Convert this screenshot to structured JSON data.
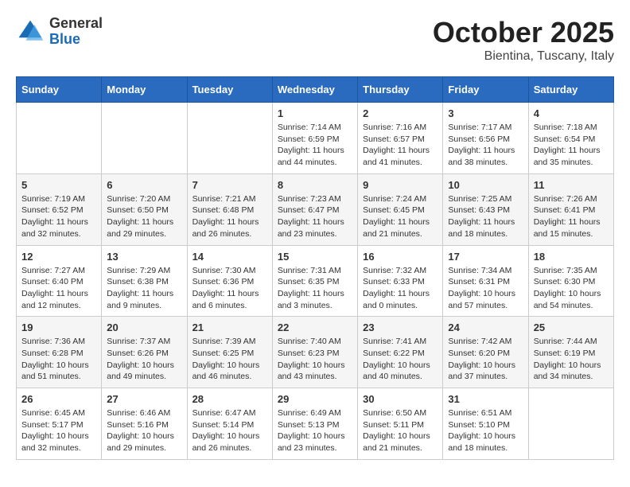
{
  "header": {
    "logo_general": "General",
    "logo_blue": "Blue",
    "title": "October 2025",
    "subtitle": "Bientina, Tuscany, Italy"
  },
  "weekdays": [
    "Sunday",
    "Monday",
    "Tuesday",
    "Wednesday",
    "Thursday",
    "Friday",
    "Saturday"
  ],
  "weeks": [
    [
      {
        "day": "",
        "info": ""
      },
      {
        "day": "",
        "info": ""
      },
      {
        "day": "",
        "info": ""
      },
      {
        "day": "1",
        "info": "Sunrise: 7:14 AM\nSunset: 6:59 PM\nDaylight: 11 hours and 44 minutes."
      },
      {
        "day": "2",
        "info": "Sunrise: 7:16 AM\nSunset: 6:57 PM\nDaylight: 11 hours and 41 minutes."
      },
      {
        "day": "3",
        "info": "Sunrise: 7:17 AM\nSunset: 6:56 PM\nDaylight: 11 hours and 38 minutes."
      },
      {
        "day": "4",
        "info": "Sunrise: 7:18 AM\nSunset: 6:54 PM\nDaylight: 11 hours and 35 minutes."
      }
    ],
    [
      {
        "day": "5",
        "info": "Sunrise: 7:19 AM\nSunset: 6:52 PM\nDaylight: 11 hours and 32 minutes."
      },
      {
        "day": "6",
        "info": "Sunrise: 7:20 AM\nSunset: 6:50 PM\nDaylight: 11 hours and 29 minutes."
      },
      {
        "day": "7",
        "info": "Sunrise: 7:21 AM\nSunset: 6:48 PM\nDaylight: 11 hours and 26 minutes."
      },
      {
        "day": "8",
        "info": "Sunrise: 7:23 AM\nSunset: 6:47 PM\nDaylight: 11 hours and 23 minutes."
      },
      {
        "day": "9",
        "info": "Sunrise: 7:24 AM\nSunset: 6:45 PM\nDaylight: 11 hours and 21 minutes."
      },
      {
        "day": "10",
        "info": "Sunrise: 7:25 AM\nSunset: 6:43 PM\nDaylight: 11 hours and 18 minutes."
      },
      {
        "day": "11",
        "info": "Sunrise: 7:26 AM\nSunset: 6:41 PM\nDaylight: 11 hours and 15 minutes."
      }
    ],
    [
      {
        "day": "12",
        "info": "Sunrise: 7:27 AM\nSunset: 6:40 PM\nDaylight: 11 hours and 12 minutes."
      },
      {
        "day": "13",
        "info": "Sunrise: 7:29 AM\nSunset: 6:38 PM\nDaylight: 11 hours and 9 minutes."
      },
      {
        "day": "14",
        "info": "Sunrise: 7:30 AM\nSunset: 6:36 PM\nDaylight: 11 hours and 6 minutes."
      },
      {
        "day": "15",
        "info": "Sunrise: 7:31 AM\nSunset: 6:35 PM\nDaylight: 11 hours and 3 minutes."
      },
      {
        "day": "16",
        "info": "Sunrise: 7:32 AM\nSunset: 6:33 PM\nDaylight: 11 hours and 0 minutes."
      },
      {
        "day": "17",
        "info": "Sunrise: 7:34 AM\nSunset: 6:31 PM\nDaylight: 10 hours and 57 minutes."
      },
      {
        "day": "18",
        "info": "Sunrise: 7:35 AM\nSunset: 6:30 PM\nDaylight: 10 hours and 54 minutes."
      }
    ],
    [
      {
        "day": "19",
        "info": "Sunrise: 7:36 AM\nSunset: 6:28 PM\nDaylight: 10 hours and 51 minutes."
      },
      {
        "day": "20",
        "info": "Sunrise: 7:37 AM\nSunset: 6:26 PM\nDaylight: 10 hours and 49 minutes."
      },
      {
        "day": "21",
        "info": "Sunrise: 7:39 AM\nSunset: 6:25 PM\nDaylight: 10 hours and 46 minutes."
      },
      {
        "day": "22",
        "info": "Sunrise: 7:40 AM\nSunset: 6:23 PM\nDaylight: 10 hours and 43 minutes."
      },
      {
        "day": "23",
        "info": "Sunrise: 7:41 AM\nSunset: 6:22 PM\nDaylight: 10 hours and 40 minutes."
      },
      {
        "day": "24",
        "info": "Sunrise: 7:42 AM\nSunset: 6:20 PM\nDaylight: 10 hours and 37 minutes."
      },
      {
        "day": "25",
        "info": "Sunrise: 7:44 AM\nSunset: 6:19 PM\nDaylight: 10 hours and 34 minutes."
      }
    ],
    [
      {
        "day": "26",
        "info": "Sunrise: 6:45 AM\nSunset: 5:17 PM\nDaylight: 10 hours and 32 minutes."
      },
      {
        "day": "27",
        "info": "Sunrise: 6:46 AM\nSunset: 5:16 PM\nDaylight: 10 hours and 29 minutes."
      },
      {
        "day": "28",
        "info": "Sunrise: 6:47 AM\nSunset: 5:14 PM\nDaylight: 10 hours and 26 minutes."
      },
      {
        "day": "29",
        "info": "Sunrise: 6:49 AM\nSunset: 5:13 PM\nDaylight: 10 hours and 23 minutes."
      },
      {
        "day": "30",
        "info": "Sunrise: 6:50 AM\nSunset: 5:11 PM\nDaylight: 10 hours and 21 minutes."
      },
      {
        "day": "31",
        "info": "Sunrise: 6:51 AM\nSunset: 5:10 PM\nDaylight: 10 hours and 18 minutes."
      },
      {
        "day": "",
        "info": ""
      }
    ]
  ]
}
